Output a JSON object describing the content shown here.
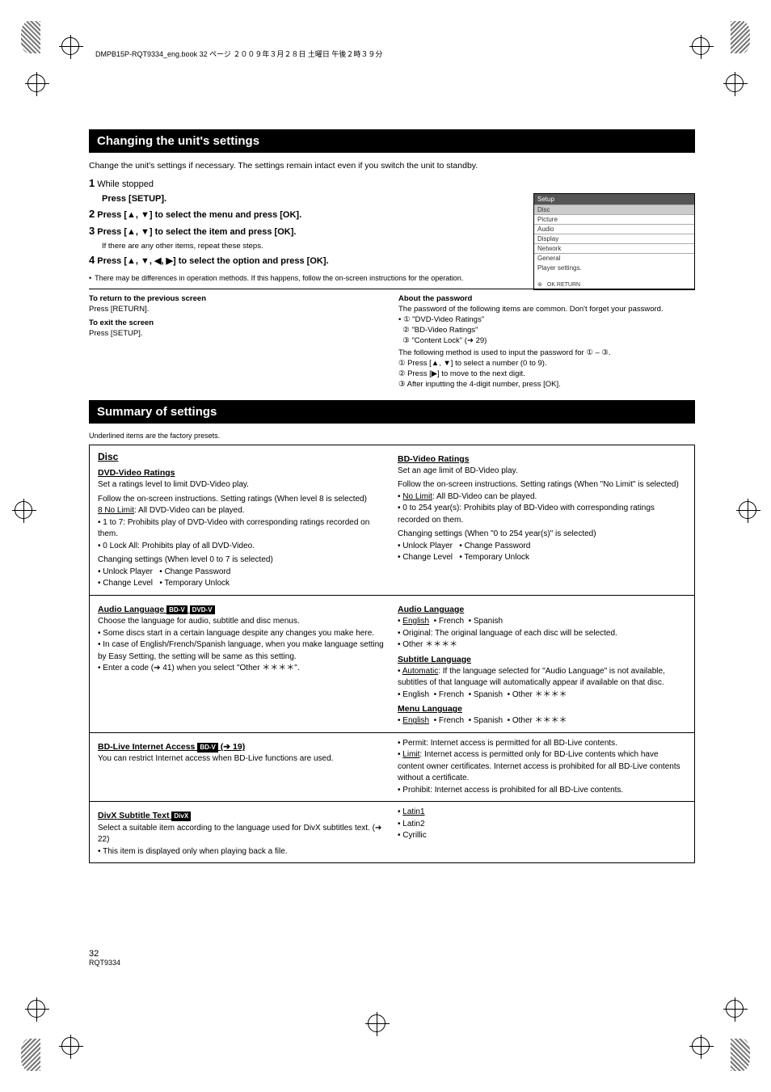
{
  "header_line": "DMPB15P-RQT9334_eng.book  32 ページ  ２００９年３月２８日  土曜日  午後２時３９分",
  "section1_title": "Changing the unit's settings",
  "intro": "Change the unit's settings if necessary. The settings remain intact even if you switch the unit to standby.",
  "steps": {
    "s1_num": "1",
    "s1_text": "While stopped",
    "s1_line": "Press [SETUP].",
    "s2_num": "2",
    "s2_text": "Press [▲, ▼] to select the menu and press [OK].",
    "s3_num": "3",
    "s3_text": "Press [▲, ▼] to select the item and press [OK].",
    "s3_sub": "If there are any other items, repeat these steps.",
    "s4_num": "4",
    "s4_text": "Press [▲, ▼, ◀, ▶] to select the option and press [OK].",
    "bullet_note": "There may be differences in operation methods. If this happens, follow the on-screen instructions for the operation."
  },
  "diagram": {
    "title": "Setup",
    "rows": [
      "Disc",
      "Picture",
      "Audio",
      "Display",
      "Network",
      "General"
    ],
    "sub_caption": "Player settings.",
    "tabs": "OK  RETURN"
  },
  "return": {
    "title": "To return to the previous screen",
    "line": "Press [RETURN].",
    "exit_title": "To exit the screen",
    "exit_line": "Press [SETUP].",
    "about_title": "About the password",
    "about_line": "The password of the following items are common. Don't forget your password.",
    "i1": "\"DVD-Video Ratings\"",
    "i2": "\"BD-Video Ratings\"",
    "i3": "\"Content Lock\" (➔ 29)",
    "method": "The following method is used to input the password for ① – ③.",
    "m1": "Press [▲, ▼] to select a number (0 to 9).",
    "m2": "Press [▶] to move to the next digit.",
    "m3": "After inputting the 4-digit number, press [OK]."
  },
  "section2_title": "Summary of settings",
  "section2_intro": "Underlined items are the factory presets.",
  "summary": {
    "disc": {
      "head": "Disc",
      "dvdv": {
        "title": "DVD-Video Ratings",
        "desc": "Set a ratings level to limit DVD-Video play.",
        "note": "Follow the on-screen instructions. Setting ratings (When level 8 is selected)",
        "opts": [
          "8 No Limit: All DVD-Video can be played.",
          "1 to 7: Prohibits play of DVD-Video with corresponding ratings recorded on them.",
          "0 Lock All: Prohibits play of all DVD-Video."
        ],
        "change": "Changing settings (When level 0 to 7 is selected)",
        "copts": [
          "Unlock Player",
          "Change Level",
          "Change Password",
          "Temporary Unlock"
        ]
      },
      "bdv": {
        "title": "BD-Video Ratings",
        "desc": "Set an age limit of BD-Video play.",
        "note": "Follow the on-screen instructions. Setting ratings (When \"No Limit\" is selected)",
        "opts": [
          "No Limit: All BD-Video can be played.",
          "0 to 254 year(s): Prohibits play of BD-Video with corresponding ratings recorded on them."
        ],
        "change": "Changing settings (When \"0 to 254 year(s)\" is selected)",
        "copts": [
          "Unlock Player",
          "Change Level",
          "Change Password",
          "Temporary Unlock"
        ]
      },
      "atl": {
        "title": "Audio Language",
        "opts": [
          "English",
          "French",
          "Spanish",
          "Original: The original language of each disc will be selected.",
          "Other ＊＊＊＊"
        ]
      },
      "stl": {
        "title": "Subtitle Language",
        "opts": [
          "Automatic: If the language selected for \"Audio Language\" is not available, subtitles of that language will automatically appear if available on that disc.",
          "English",
          "French",
          "Spanish",
          "Other ＊＊＊＊"
        ]
      },
      "mnl": {
        "title": "Menu Language",
        "opts": [
          "English",
          "French",
          "Spanish",
          "Other ＊＊＊＊"
        ]
      },
      "lang_note": "Choose the language for audio, subtitle and disc menus.",
      "lang_bullets": [
        "Some discs start in a certain language despite any changes you make here.",
        "In case of English/French/Spanish language, when you make language setting by Easy Setting, the setting will be same as this setting.",
        "Enter a code (➔ 41) when you select \"Other ＊＊＊＊\"."
      ],
      "bdli": {
        "title": "BD-Live Internet Access (➔ 19)",
        "desc": "You can restrict Internet access when BD-Live functions are used.",
        "opts": [
          "Permit: Internet access is permitted for all BD-Live contents.",
          "Limit: Internet access is permitted only for BD-Live contents which have content owner certificates. Internet access is prohibited for all BD-Live contents without a certificate.",
          "Prohibit: Internet access is prohibited for all BD-Live contents."
        ]
      },
      "divx": {
        "title": "DivX Subtitle Text",
        "desc": "Select a suitable item according to the language used for DivX subtitles text. (➔ 22)",
        "note": "This item is displayed only when playing back a file.",
        "opts": [
          "Latin1",
          "Latin2",
          "Cyrillic"
        ]
      }
    }
  },
  "footer": {
    "page": "32",
    "code": "RQT9334"
  }
}
